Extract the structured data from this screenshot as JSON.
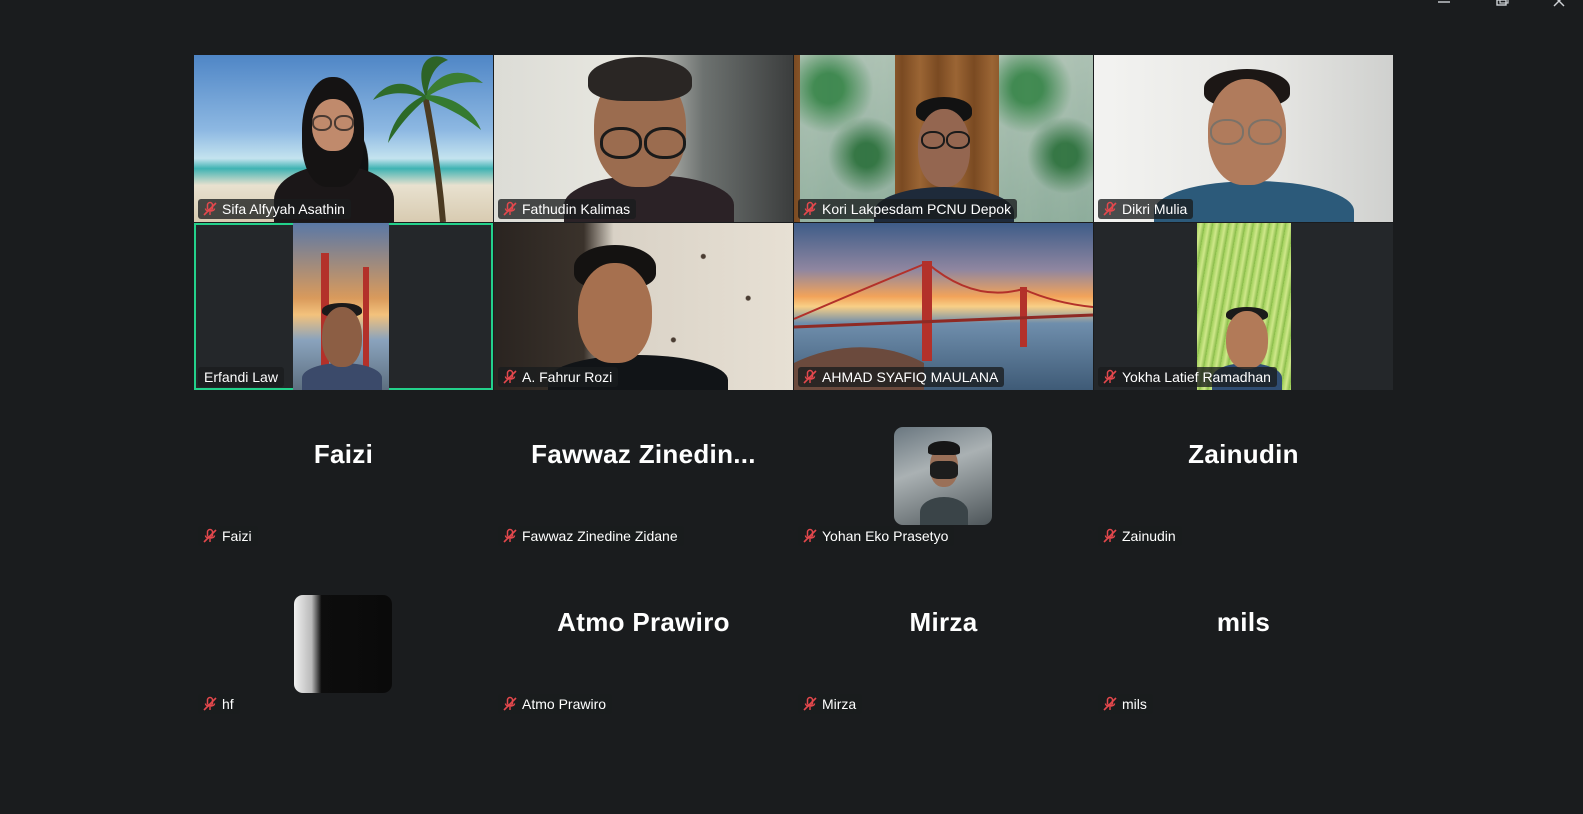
{
  "window_controls": [
    "minimize-icon",
    "restore-icon",
    "close-icon"
  ],
  "colors": {
    "background": "#1a1c1e",
    "active_speaker_border": "#23d18b",
    "mic_muted": "#e5484d",
    "nametag_text": "#ffffff"
  },
  "video_rows": [
    [
      {
        "name": "Sifa Alfyyah Asathin",
        "muted": true,
        "background": "beach"
      },
      {
        "name": "Fathudin Kalimas",
        "muted": true,
        "background": "office"
      },
      {
        "name": "Kori Lakpesdam PCNU Depok",
        "muted": true,
        "background": "stained-glass"
      },
      {
        "name": "Dikri Mulia",
        "muted": true,
        "background": "white-room"
      }
    ],
    [
      {
        "name": "Erfandi Law",
        "muted": false,
        "active": true,
        "background": "golden-gate"
      },
      {
        "name": "A. Fahrur Rozi",
        "muted": true,
        "background": "wall"
      },
      {
        "name": "AHMAD SYAFIQ MAULANA",
        "muted": true,
        "background": "golden-gate"
      },
      {
        "name": "Yokha Latief Ramadhan",
        "muted": true,
        "background": "grass"
      }
    ]
  ],
  "no_video_rows": [
    [
      {
        "display": "Faizi",
        "name": "Faizi",
        "muted": true
      },
      {
        "display": "Fawwaz  Zinedin...",
        "name": "Fawwaz Zinedine Zidane",
        "muted": true
      },
      {
        "display": "",
        "name": "Yohan Eko Prasetyo",
        "muted": true,
        "avatar": "photo"
      },
      {
        "display": "Zainudin",
        "name": "Zainudin",
        "muted": true
      }
    ],
    [
      {
        "display": "",
        "name": "hf",
        "muted": true,
        "avatar": "photo"
      },
      {
        "display": "Atmo Prawiro",
        "name": "Atmo Prawiro",
        "muted": true
      },
      {
        "display": "Mirza",
        "name": "Mirza",
        "muted": true
      },
      {
        "display": "mils",
        "name": "mils",
        "muted": true
      }
    ]
  ]
}
